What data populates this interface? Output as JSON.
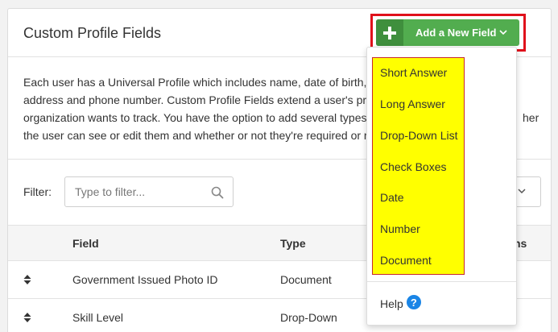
{
  "panel": {
    "title": "Custom Profile Fields",
    "description_lines": [
      "Each user has a Universal Profile which includes name, date of birth, ge",
      "address and phone number. Custom Profile Fields extend a user's profi",
      "organization wants to track. You have the option to add several types c",
      "the user can see or edit them and whether or not they're required or rec"
    ],
    "description_tail": "her"
  },
  "filter": {
    "label": "Filter:",
    "placeholder": "Type to filter..."
  },
  "table": {
    "headers": {
      "field": "Field",
      "type": "Type",
      "tail": "ns"
    },
    "rows": [
      {
        "field": "Government Issued Photo ID",
        "type": "Document"
      },
      {
        "field": "Skill Level",
        "type": "Drop-Down"
      }
    ]
  },
  "add_button": {
    "label": "Add a New Field"
  },
  "dropdown": {
    "items": [
      "Short Answer",
      "Long Answer",
      "Drop-Down List",
      "Check Boxes",
      "Date",
      "Number",
      "Document"
    ],
    "help_label": "Help",
    "help_glyph": "?"
  },
  "colors": {
    "button_green": "#52ad4f",
    "button_green_dark": "#3f8f3d",
    "highlight_red": "#e0101b",
    "highlight_yellow": "#ffff00",
    "help_blue": "#1a85e6"
  }
}
